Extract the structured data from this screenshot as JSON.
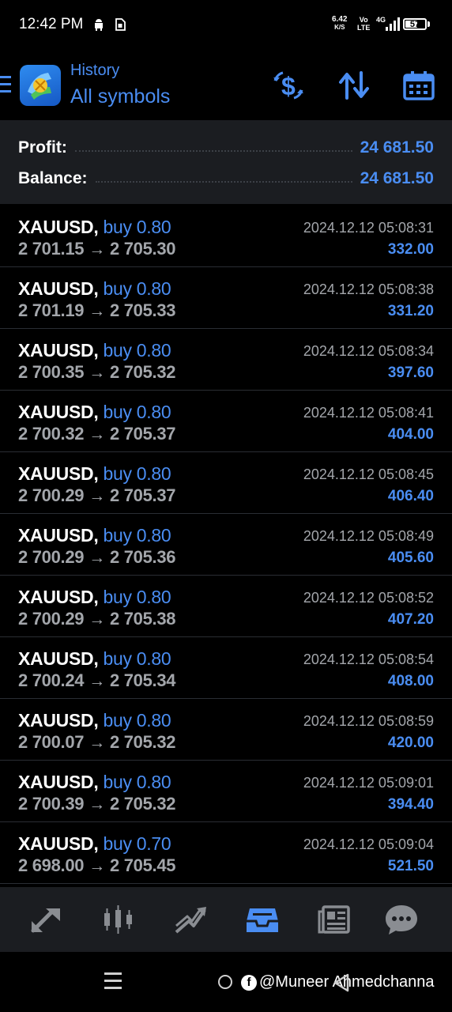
{
  "status_bar": {
    "time": "12:42 PM",
    "net_speed": "6.42",
    "net_unit": "K/S",
    "volte_top": "Vo",
    "volte_bottom": "LTE",
    "network": "4G",
    "battery": "57",
    "icons": [
      "android-icon",
      "sim-icon",
      "signal-icon",
      "battery-icon"
    ]
  },
  "header": {
    "subtitle": "History",
    "title": "All symbols",
    "buttons": [
      "currency-sort-icon",
      "sort-arrows-icon",
      "calendar-icon"
    ]
  },
  "summary": {
    "profit_label": "Profit:",
    "profit_value": "24 681.50",
    "balance_label": "Balance:",
    "balance_value": "24 681.50"
  },
  "trades": [
    {
      "symbol": "XAUUSD,",
      "type": "buy 0.80",
      "open": "2 701.15",
      "close": "2 705.30",
      "time": "2024.12.12 05:08:31",
      "profit": "332.00"
    },
    {
      "symbol": "XAUUSD,",
      "type": "buy 0.80",
      "open": "2 701.19",
      "close": "2 705.33",
      "time": "2024.12.12 05:08:38",
      "profit": "331.20"
    },
    {
      "symbol": "XAUUSD,",
      "type": "buy 0.80",
      "open": "2 700.35",
      "close": "2 705.32",
      "time": "2024.12.12 05:08:34",
      "profit": "397.60"
    },
    {
      "symbol": "XAUUSD,",
      "type": "buy 0.80",
      "open": "2 700.32",
      "close": "2 705.37",
      "time": "2024.12.12 05:08:41",
      "profit": "404.00"
    },
    {
      "symbol": "XAUUSD,",
      "type": "buy 0.80",
      "open": "2 700.29",
      "close": "2 705.37",
      "time": "2024.12.12 05:08:45",
      "profit": "406.40"
    },
    {
      "symbol": "XAUUSD,",
      "type": "buy 0.80",
      "open": "2 700.29",
      "close": "2 705.36",
      "time": "2024.12.12 05:08:49",
      "profit": "405.60"
    },
    {
      "symbol": "XAUUSD,",
      "type": "buy 0.80",
      "open": "2 700.29",
      "close": "2 705.38",
      "time": "2024.12.12 05:08:52",
      "profit": "407.20"
    },
    {
      "symbol": "XAUUSD,",
      "type": "buy 0.80",
      "open": "2 700.24",
      "close": "2 705.34",
      "time": "2024.12.12 05:08:54",
      "profit": "408.00"
    },
    {
      "symbol": "XAUUSD,",
      "type": "buy 0.80",
      "open": "2 700.07",
      "close": "2 705.32",
      "time": "2024.12.12 05:08:59",
      "profit": "420.00"
    },
    {
      "symbol": "XAUUSD,",
      "type": "buy 0.80",
      "open": "2 700.39",
      "close": "2 705.32",
      "time": "2024.12.12 05:09:01",
      "profit": "394.40"
    },
    {
      "symbol": "XAUUSD,",
      "type": "buy 0.70",
      "open": "2 698.00",
      "close": "2 705.45",
      "time": "2024.12.12 05:09:04",
      "profit": "521.50"
    }
  ],
  "arrow_glyph": "→",
  "bottom_nav": {
    "items": [
      "quotes-icon",
      "chart-icon",
      "trade-icon",
      "history-icon",
      "news-icon",
      "chat-icon"
    ],
    "active": "history-icon"
  },
  "watermark": {
    "fb_glyph": "f",
    "text": "@Muneer Ahmedchanna"
  },
  "colors": {
    "accent": "#4a8df2",
    "background": "#000000",
    "panel": "#1b1d21",
    "muted_text": "#a3a6ab"
  }
}
